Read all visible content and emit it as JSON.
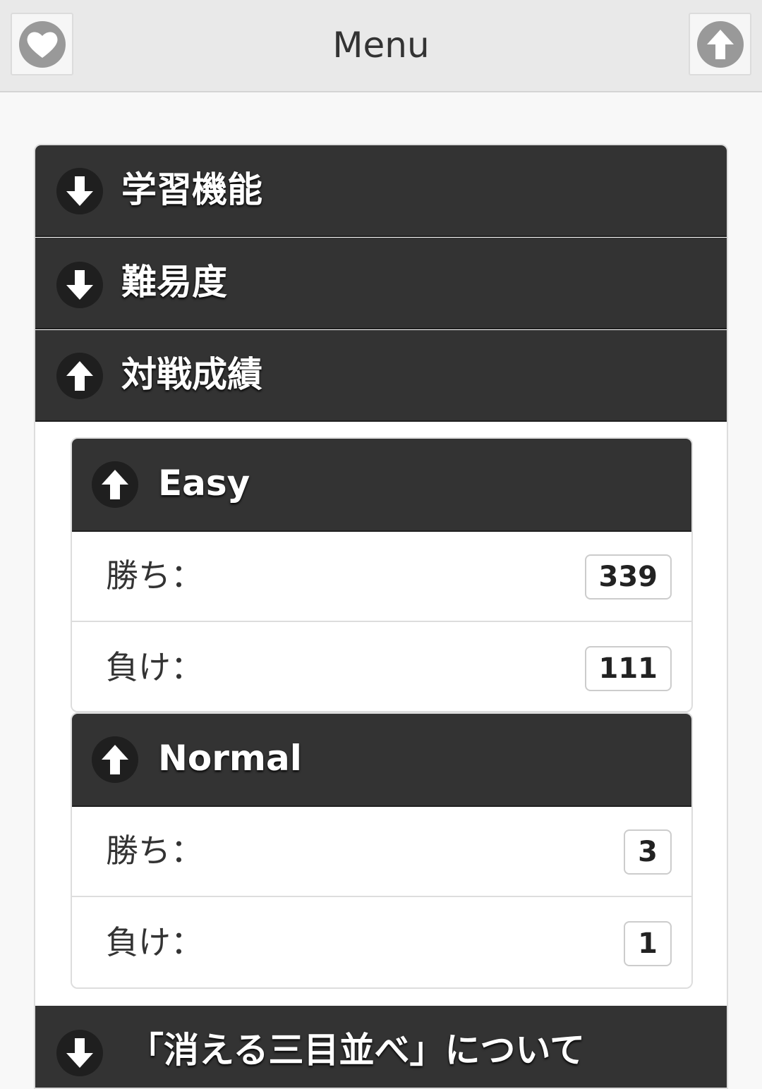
{
  "header": {
    "title": "Menu",
    "left_icon": "heart-icon",
    "right_icon": "arrow-up-icon"
  },
  "menu": {
    "categories": [
      {
        "label": "学習機能",
        "icon": "arrow-down-icon",
        "expanded": false
      },
      {
        "label": "難易度",
        "icon": "arrow-down-icon",
        "expanded": false
      },
      {
        "label": "対戦成績",
        "icon": "arrow-up-icon",
        "expanded": true
      },
      {
        "label": "「消える三目並べ」について",
        "icon": "arrow-down-icon",
        "expanded": false
      }
    ],
    "stats": [
      {
        "label": "Easy",
        "icon": "arrow-up-icon",
        "wins_label": "勝ち：",
        "wins": "339",
        "losses_label": "負け：",
        "losses": "111"
      },
      {
        "label": "Normal",
        "icon": "arrow-up-icon",
        "wins_label": "勝ち：",
        "wins": "3",
        "losses_label": "負け：",
        "losses": "1"
      }
    ]
  },
  "colors": {
    "header_bg": "#e9e9e9",
    "bar_bg": "#333333",
    "page_bg": "#f8f8f8"
  }
}
